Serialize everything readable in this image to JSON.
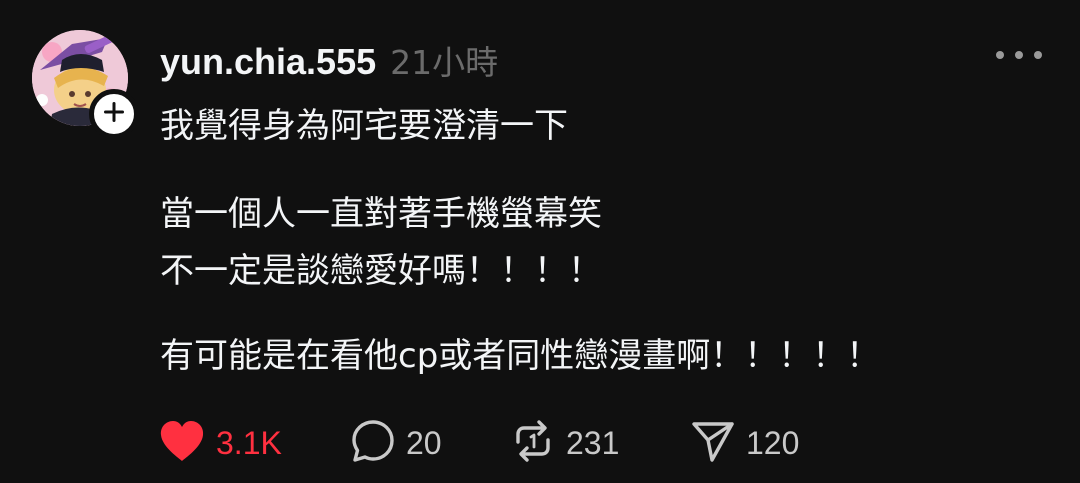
{
  "post": {
    "username": "yun.chia.555",
    "time": "21小時",
    "lines": [
      "我覺得身為阿宅要澄清一下",
      "當一個人一直對著手機螢幕笑",
      "不一定是談戀愛好嗎！！！！",
      "有可能是在看他cp或者同性戀漫畫啊！！！！！"
    ],
    "actions": {
      "likes": "3.1K",
      "comments": "20",
      "reposts": "231",
      "shares": "120"
    }
  },
  "icons": {
    "like": "heart-icon",
    "comment": "comment-bubble-icon",
    "repost": "repost-icon",
    "share": "send-icon",
    "more": "more-dots-icon",
    "follow": "plus-icon"
  },
  "colors": {
    "background": "#101010",
    "text": "#f3f5f7",
    "muted": "#6b6b6b",
    "like": "#ff3040"
  }
}
